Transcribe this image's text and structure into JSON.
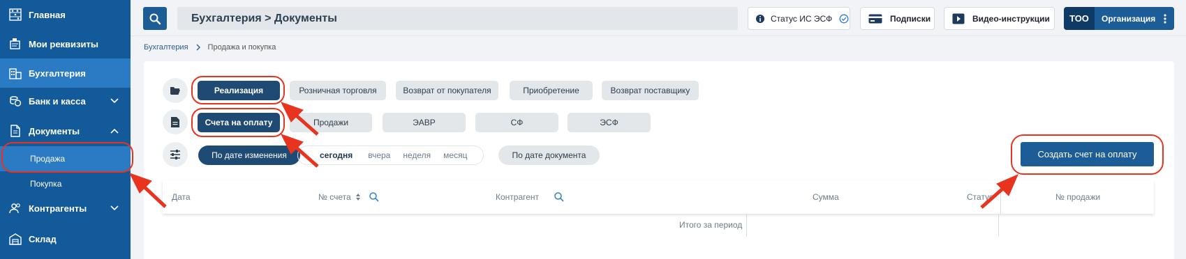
{
  "sidebar": {
    "items": [
      {
        "label": "Главная",
        "icon": "abacus-icon"
      },
      {
        "label": "Мои реквизиты",
        "icon": "requisites-icon"
      },
      {
        "label": "Бухгалтерия",
        "icon": "accounting-icon"
      },
      {
        "label": "Банк и касса",
        "icon": "coins-icon"
      },
      {
        "label": "Документы",
        "icon": "documents-icon"
      },
      {
        "label": "Контрагенты",
        "icon": "counterparties-icon"
      },
      {
        "label": "Склад",
        "icon": "warehouse-icon"
      }
    ],
    "subitems": [
      {
        "label": "Продажа"
      },
      {
        "label": "Покупка"
      }
    ]
  },
  "header": {
    "title": "Бухгалтерия > Документы",
    "status_btn": "Статус ИС ЭСФ",
    "subscriptions_btn": "Подписки",
    "video_btn": "Видео-инструкции",
    "org_type": "ТОО",
    "org_name": "Организация"
  },
  "breadcrumb": {
    "root": "Бухгалтерия",
    "current": "Продажа и покупка"
  },
  "filters": {
    "row1": [
      "Реализация",
      "Розничная торговля",
      "Возврат от покупателя",
      "Приобретение",
      "Возврат поставщику"
    ],
    "row2": [
      "Счета на оплату",
      "Продажи",
      "ЭАВР",
      "СФ",
      "ЭСФ"
    ],
    "sort_by_change": "По дате изменения",
    "periods": [
      "сегодня",
      "вчера",
      "неделя",
      "месяц"
    ],
    "sort_by_doc": "По дате документа"
  },
  "create_button": "Создать счет на оплату",
  "table": {
    "columns": {
      "date": "Дата",
      "invoice_no": "№ счета",
      "counterparty": "Контрагент",
      "sum": "Сумма",
      "status": "Статус",
      "sale_no": "№ продажи"
    },
    "total_label": "Итого за период"
  },
  "colors": {
    "sidebar": "#135a9a",
    "sidebar_active": "#2a7bc4",
    "primary": "#1c5c97",
    "pill_active": "#1f4a74",
    "annotation": "#e8331f"
  }
}
